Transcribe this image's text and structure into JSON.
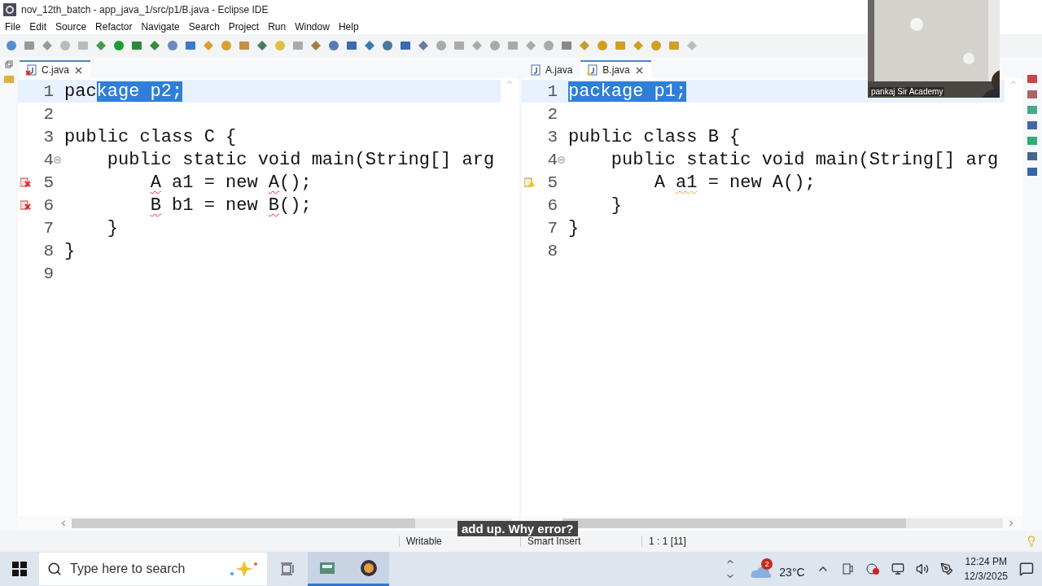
{
  "window": {
    "title": "nov_12th_batch - app_java_1/src/p1/B.java - Eclipse IDE"
  },
  "menu": [
    "File",
    "Edit",
    "Source",
    "Refactor",
    "Navigate",
    "Search",
    "Project",
    "Run",
    "Window",
    "Help"
  ],
  "editors": [
    {
      "tabs": [
        {
          "label": "C.java",
          "selected": true,
          "kind": "error",
          "closable": true
        }
      ],
      "lines": [
        {
          "number": "1",
          "current": true,
          "kind": "plain",
          "fold": false,
          "segments": [
            {
              "text": "pac",
              "kind": "plain"
            },
            {
              "text": "kage p2;",
              "kind": "selected"
            }
          ]
        },
        {
          "number": "2",
          "current": false,
          "kind": "plain",
          "fold": false
        },
        {
          "number": "3",
          "current": false,
          "kind": "plain",
          "fold": false,
          "segments": [
            {
              "text": "public class C {",
              "kind": "plain"
            }
          ]
        },
        {
          "number": "4",
          "current": false,
          "kind": "plain",
          "fold": true,
          "segments": [
            {
              "text": "    public static void main(String[] arg",
              "kind": "plain"
            }
          ]
        },
        {
          "number": "5",
          "current": false,
          "kind": "error",
          "fold": false,
          "segments": [
            {
              "text": "        A",
              "kind": "error"
            },
            {
              "text": " a1 = new ",
              "kind": "plain"
            },
            {
              "text": "A",
              "kind": "error"
            },
            {
              "text": "();",
              "kind": "plain"
            }
          ]
        },
        {
          "number": "6",
          "current": false,
          "kind": "error",
          "fold": false,
          "segments": [
            {
              "text": "        B",
              "kind": "error"
            },
            {
              "text": " b1 = new ",
              "kind": "plain"
            },
            {
              "text": "B",
              "kind": "error"
            },
            {
              "text": "();",
              "kind": "plain"
            }
          ]
        },
        {
          "number": "7",
          "current": false,
          "kind": "plain",
          "fold": false,
          "segments": [
            {
              "text": "    }",
              "kind": "plain"
            }
          ]
        },
        {
          "number": "8",
          "current": false,
          "kind": "plain",
          "fold": false,
          "segments": [
            {
              "text": "}",
              "kind": "plain"
            }
          ]
        },
        {
          "number": "9",
          "current": false,
          "kind": "plain",
          "fold": false
        }
      ]
    },
    {
      "tabs": [
        {
          "label": "A.java",
          "selected": false,
          "kind": "plain",
          "closable": false
        },
        {
          "label": "B.java",
          "selected": true,
          "kind": "warning",
          "closable": true
        }
      ],
      "lines": [
        {
          "number": "1",
          "current": true,
          "kind": "plain",
          "fold": false,
          "segments": [
            {
              "text": "package p1;",
              "kind": "selected"
            }
          ]
        },
        {
          "number": "2",
          "current": false,
          "kind": "plain",
          "fold": false
        },
        {
          "number": "3",
          "current": false,
          "kind": "plain",
          "fold": false,
          "segments": [
            {
              "text": "public class B {",
              "kind": "plain"
            }
          ]
        },
        {
          "number": "4",
          "current": false,
          "kind": "plain",
          "fold": true,
          "segments": [
            {
              "text": "    public static void main(String[] arg",
              "kind": "plain"
            }
          ]
        },
        {
          "number": "5",
          "current": false,
          "kind": "warning",
          "fold": false,
          "segments": [
            {
              "text": "        A ",
              "kind": "plain"
            },
            {
              "text": "a1",
              "kind": "warning"
            },
            {
              "text": " = new A();",
              "kind": "plain"
            }
          ]
        },
        {
          "number": "6",
          "current": false,
          "kind": "plain",
          "fold": false,
          "segments": [
            {
              "text": "    }",
              "kind": "plain"
            }
          ]
        },
        {
          "number": "7",
          "current": false,
          "kind": "plain",
          "fold": false,
          "segments": [
            {
              "text": "}",
              "kind": "plain"
            }
          ]
        },
        {
          "number": "8",
          "current": false,
          "kind": "plain",
          "fold": false
        }
      ]
    }
  ],
  "webcam": {
    "name": "pankaj Sir Academy"
  },
  "caption": "add up. Why error?",
  "status_bar": [
    "Writable",
    "Smart Insert",
    "1 : 1 [11]"
  ],
  "taskbar": {
    "search_placeholder": "Type here to search",
    "weather_badge": "2",
    "temperature": "23°C",
    "time": "12:24 PM",
    "date": "12/3/2025"
  }
}
